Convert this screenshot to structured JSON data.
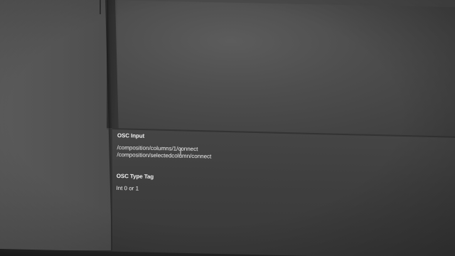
{
  "info_panel": {
    "osc_input": {
      "title": "OSC Input",
      "addresses": [
        "/composition/columns/1/connect",
        "/composition/selectedcolumn/connect"
      ]
    },
    "osc_type_tag": {
      "title": "OSC Type Tag",
      "value": "Int 0 or 1"
    }
  }
}
